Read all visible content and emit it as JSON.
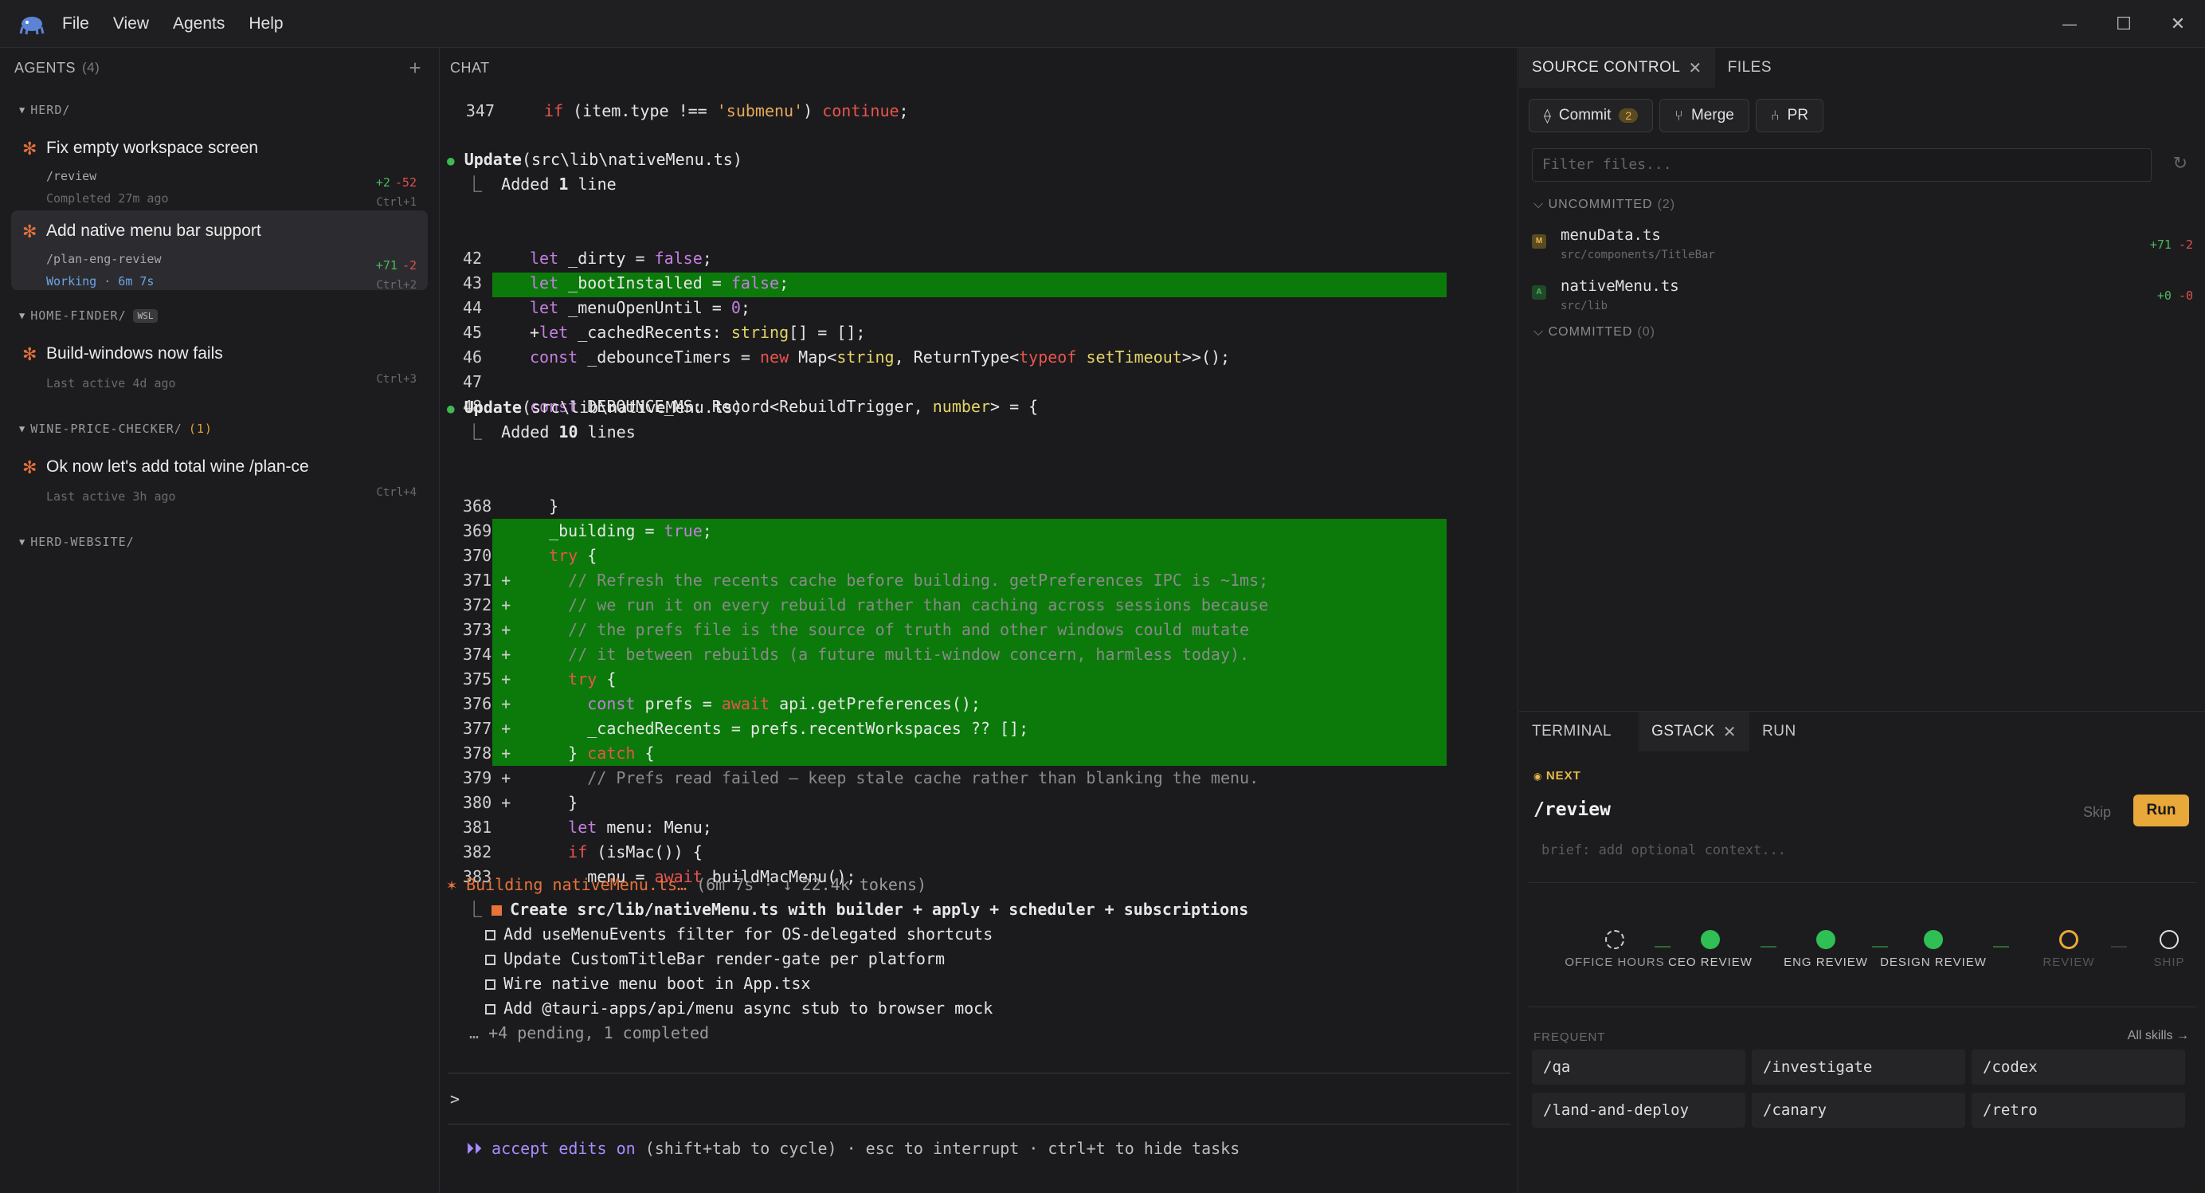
{
  "menu": [
    "File",
    "View",
    "Agents",
    "Help"
  ],
  "window_controls": {
    "minimize": "—",
    "maximize": "☐",
    "close": "✕"
  },
  "agents_panel": {
    "title": "AGENTS",
    "count": "(4)",
    "add": "+",
    "groups": [
      {
        "name": "HERD/"
      },
      {
        "name": "HOME-FINDER/",
        "badge": "WSL"
      },
      {
        "name": "WINE-PRICE-CHECKER/",
        "count": "(1)"
      },
      {
        "name": "HERD-WEBSITE/"
      }
    ],
    "agents": [
      {
        "title": "Fix empty workspace screen",
        "cmd": "/review",
        "meta": "Completed 27m ago",
        "add": "+2",
        "del": "-52",
        "key": "Ctrl+1"
      },
      {
        "title": "Add native menu bar support",
        "cmd": "/plan-eng-review",
        "meta": "Working · 6m 7s",
        "add": "+71",
        "del": "-2",
        "key": "Ctrl+2"
      },
      {
        "title": "Build-windows now fails",
        "meta": "Last active 4d ago",
        "key": "Ctrl+3"
      },
      {
        "title": "Ok now let's add total wine /plan-ce",
        "meta": "Last active 3h ago",
        "key": "Ctrl+4"
      }
    ]
  },
  "chat": {
    "title": "CHAT",
    "line347": {
      "ln": "347",
      "a": "if",
      "b": " (item.type !== ",
      "c": "'submenu'",
      "d": ") ",
      "e": "continue",
      "f": ";"
    },
    "update1": {
      "label": "Update",
      "path": "(src\\lib\\nativeMenu.ts)",
      "added_pre": "Added ",
      "added_num": "1",
      "added_post": " line"
    },
    "block1": [
      {
        "ln": "42",
        "text": "let _dirty = false;"
      },
      {
        "ln": "43",
        "text": "let _bootInstalled = false;"
      },
      {
        "ln": "44",
        "text": "let _menuOpenUntil = 0;"
      },
      {
        "ln": "45",
        "text": "+let _cachedRecents: string[] = [];"
      },
      {
        "ln": "46",
        "text": "const _debounceTimers = new Map<string, ReturnType<typeof setTimeout>>();"
      },
      {
        "ln": "47",
        "text": ""
      },
      {
        "ln": "48",
        "text": "const DEBOUNCE_MS: Record<RebuildTrigger, number> = {"
      }
    ],
    "update2": {
      "label": "Update",
      "path": "(src\\lib\\nativeMenu.ts)",
      "added_pre": "Added ",
      "added_num": "10",
      "added_post": " lines"
    },
    "block2": [
      {
        "ln": "368",
        "text": "  }"
      },
      {
        "ln": "369",
        "text": "  _building = true;"
      },
      {
        "ln": "370",
        "text": "  try {"
      },
      {
        "ln": "371 +",
        "text": "    // Refresh the recents cache before building. getPreferences IPC is ~1ms;"
      },
      {
        "ln": "372 +",
        "text": "    // we run it on every rebuild rather than caching across sessions because"
      },
      {
        "ln": "373 +",
        "text": "    // the prefs file is the source of truth and other windows could mutate"
      },
      {
        "ln": "374 +",
        "text": "    // it between rebuilds (a future multi-window concern, harmless today)."
      },
      {
        "ln": "375 +",
        "text": "    try {"
      },
      {
        "ln": "376 +",
        "text": "      const prefs = await api.getPreferences();"
      },
      {
        "ln": "377 +",
        "text": "      _cachedRecents = prefs.recentWorkspaces ?? [];"
      },
      {
        "ln": "378 +",
        "text": "    } catch {"
      },
      {
        "ln": "379 +",
        "text": "      // Prefs read failed — keep stale cache rather than blanking the menu."
      },
      {
        "ln": "380 +",
        "text": "    }"
      },
      {
        "ln": "381",
        "text": "    let menu: Menu;"
      },
      {
        "ln": "382",
        "text": "    if (isMac()) {"
      },
      {
        "ln": "383",
        "text": "      menu = await buildMacMenu();"
      }
    ],
    "building": {
      "label": "Building nativeMenu.ts…",
      "info": " (6m 7s · ↓ 22.4k tokens)"
    },
    "tasks": [
      {
        "text": "Create src/lib/nativeMenu.ts with builder + apply + scheduler + subscriptions",
        "active": true
      },
      {
        "text": "Add useMenuEvents filter for OS-delegated shortcuts"
      },
      {
        "text": "Update CustomTitleBar render-gate per platform"
      },
      {
        "text": "Wire native menu boot in App.tsx"
      },
      {
        "text": "Add @tauri-apps/api/menu async stub to browser mock"
      }
    ],
    "pending": "… +4 pending, 1 completed",
    "prompt": ">",
    "status": {
      "icon": "⏵⏵",
      "accept": "accept edits on",
      "rest": " (shift+tab to cycle) · esc to interrupt · ctrl+t to hide tasks"
    }
  },
  "source_control": {
    "tabs": [
      {
        "label": "SOURCE CONTROL",
        "close": "✕"
      },
      {
        "label": "FILES"
      }
    ],
    "buttons": {
      "commit": "Commit",
      "commit_badge": "2",
      "merge": "Merge",
      "pr": "PR"
    },
    "filter_placeholder": "Filter files...",
    "uncommitted": {
      "label": "UNCOMMITTED",
      "count": "(2)"
    },
    "files": [
      {
        "status": "M",
        "name": "menuData.ts",
        "path": "src/components/TitleBar",
        "add": "+71",
        "del": "-2"
      },
      {
        "status": "A",
        "name": "nativeMenu.ts",
        "path": "src/lib",
        "add": "+0",
        "del": "-0"
      }
    ],
    "committed": {
      "label": "COMMITTED",
      "count": "(0)"
    }
  },
  "lower_panel": {
    "tabs": [
      {
        "label": "TERMINAL"
      },
      {
        "label": "GSTACK",
        "close": "✕"
      },
      {
        "label": "RUN"
      }
    ],
    "next_label": "NEXT",
    "next_cmd": "/review",
    "skip": "Skip",
    "run": "Run",
    "context_placeholder": "brief: add optional context...",
    "stages": [
      {
        "label": "OFFICE HOURS",
        "state": "pending"
      },
      {
        "label": "CEO REVIEW",
        "state": "done"
      },
      {
        "label": "ENG REVIEW",
        "state": "done"
      },
      {
        "label": "DESIGN REVIEW",
        "state": "done"
      },
      {
        "label": "REVIEW",
        "state": "current"
      },
      {
        "label": "SHIP",
        "state": "todo"
      }
    ],
    "frequent_label": "FREQUENT",
    "all_skills": "All skills →",
    "skills": [
      "/qa",
      "/investigate",
      "/codex",
      "/land-and-deploy",
      "/canary",
      "/retro"
    ]
  },
  "colors": {
    "accent_orange": "#e8a83a",
    "add_green": "#4cb85a",
    "del_red": "#e05050",
    "diff_bg": "#0b7a0b"
  }
}
